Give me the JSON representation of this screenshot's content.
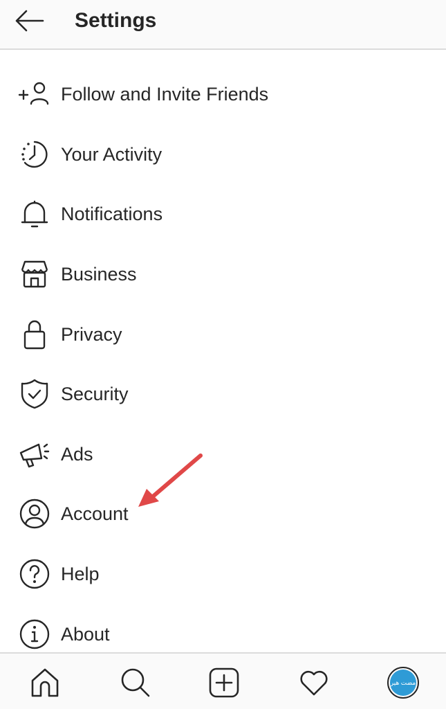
{
  "header": {
    "title": "Settings",
    "back_icon": "arrow-left-icon"
  },
  "menu": [
    {
      "label": "Follow and Invite Friends",
      "icon": "add-person-icon"
    },
    {
      "label": "Your Activity",
      "icon": "activity-clock-icon"
    },
    {
      "label": "Notifications",
      "icon": "bell-icon"
    },
    {
      "label": "Business",
      "icon": "shop-icon"
    },
    {
      "label": "Privacy",
      "icon": "lock-icon"
    },
    {
      "label": "Security",
      "icon": "shield-check-icon"
    },
    {
      "label": "Ads",
      "icon": "megaphone-icon"
    },
    {
      "label": "Account",
      "icon": "user-circle-icon"
    },
    {
      "label": "Help",
      "icon": "help-circle-icon"
    },
    {
      "label": "About",
      "icon": "info-circle-icon"
    }
  ],
  "annotation": {
    "type": "arrow",
    "target": "Account",
    "color": "#e04848"
  },
  "bottom_nav": [
    {
      "name": "home",
      "icon": "home-icon"
    },
    {
      "name": "search",
      "icon": "search-icon"
    },
    {
      "name": "new-post",
      "icon": "plus-square-icon"
    },
    {
      "name": "activity",
      "icon": "heart-icon"
    },
    {
      "name": "profile",
      "icon": "avatar",
      "avatar_text": "مضت هير",
      "avatar_color": "#2e9bd6"
    }
  ]
}
